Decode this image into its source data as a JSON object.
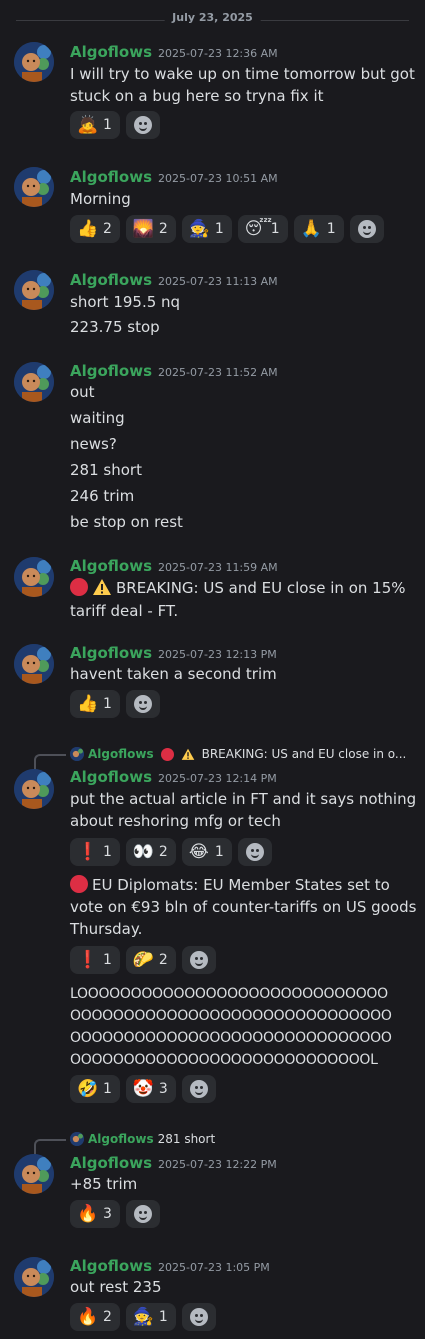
{
  "date_divider": "July 23, 2025",
  "messages": [
    {
      "author": "Algoflows",
      "timestamp": "2025-07-23 12:36 AM",
      "lines": [
        "I will try to wake up on time tomorrow but got",
        "stuck on a bug here so tryna fix it"
      ],
      "reactions": [
        {
          "emoji": "🙇",
          "count": "1"
        }
      ]
    },
    {
      "author": "Algoflows",
      "timestamp": "2025-07-23 10:51 AM",
      "lines": [
        "Morning"
      ],
      "reactions": [
        {
          "emoji": "👍",
          "count": "2"
        },
        {
          "emoji": "🌄",
          "count": "2"
        },
        {
          "emoji": "🧙",
          "count": "1"
        },
        {
          "emoji": "😴",
          "count": "1"
        },
        {
          "emoji": "🙏",
          "count": "1"
        }
      ]
    },
    {
      "author": "Algoflows",
      "timestamp": "2025-07-23 11:13 AM",
      "lines": [
        "short 195.5 nq",
        "223.75 stop"
      ]
    },
    {
      "author": "Algoflows",
      "timestamp": "2025-07-23 11:52 AM",
      "lines": [
        "out",
        "waiting",
        "news?",
        "281 short",
        "246 trim",
        "be stop on rest"
      ]
    },
    {
      "author": "Algoflows",
      "timestamp": "2025-07-23 11:59 AM",
      "lines": [
        "BREAKING: US and EU close in on 15%",
        "tariff deal - FT."
      ]
    },
    {
      "author": "Algoflows",
      "timestamp": "2025-07-23 12:13 PM",
      "lines": [
        "havent taken a second trim"
      ],
      "reactions": [
        {
          "emoji": "👍",
          "count": "1"
        }
      ]
    },
    {
      "reply_to": {
        "author": "Algoflows",
        "text": "BREAKING: US and EU close in o..."
      },
      "author": "Algoflows",
      "timestamp": "2025-07-23 12:14 PM",
      "lines": [
        "put the actual article in FT and it says nothing",
        "about reshoring mfg or tech"
      ],
      "reactions": [
        {
          "emoji": "❗",
          "count": "1"
        },
        {
          "emoji": "👀",
          "count": "2"
        },
        {
          "emoji": "😂",
          "count": "1"
        }
      ],
      "follow_lines": [
        "EU Diplomats: EU Member States set to",
        "vote on €93 bln of counter-tariffs on US goods",
        "Thursday."
      ],
      "follow_reactions": [
        {
          "emoji": "❗",
          "count": "1"
        },
        {
          "emoji": "🌮",
          "count": "2"
        }
      ],
      "loud_lines": [
        "LOOOOOOOOOOOOOOOOOOOOOOOOOOOOO",
        "OOOOOOOOOOOOOOOOOOOOOOOOOOOOOO",
        "OOOOOOOOOOOOOOOOOOOOOOOOOOOOOO",
        "OOOOOOOOOOOOOOOOOOOOOOOOOOOOL"
      ],
      "loud_reactions": [
        {
          "emoji": "🤣",
          "count": "1"
        },
        {
          "emoji": "🤡",
          "count": "3"
        }
      ]
    },
    {
      "reply_to": {
        "author": "Algoflows",
        "text": "281 short"
      },
      "author": "Algoflows",
      "timestamp": "2025-07-23 12:22 PM",
      "lines": [
        "+85 trim"
      ],
      "reactions": [
        {
          "emoji": "🔥",
          "count": "3"
        }
      ]
    },
    {
      "author": "Algoflows",
      "timestamp": "2025-07-23 1:05 PM",
      "lines": [
        "out rest 235"
      ],
      "reactions": [
        {
          "emoji": "🔥",
          "count": "2"
        },
        {
          "emoji": "🧙",
          "count": "1"
        }
      ]
    }
  ],
  "icons": {
    "avatar": "avatar-icon",
    "add_reaction": "add-reaction-icon",
    "red_circle": "red-circle-icon",
    "warning": "warning-icon"
  },
  "colors": {
    "background": "#1a1a1e",
    "author": "#3ba55d",
    "timestamp": "#949ba4",
    "reaction_bg": "#2b2d31"
  }
}
